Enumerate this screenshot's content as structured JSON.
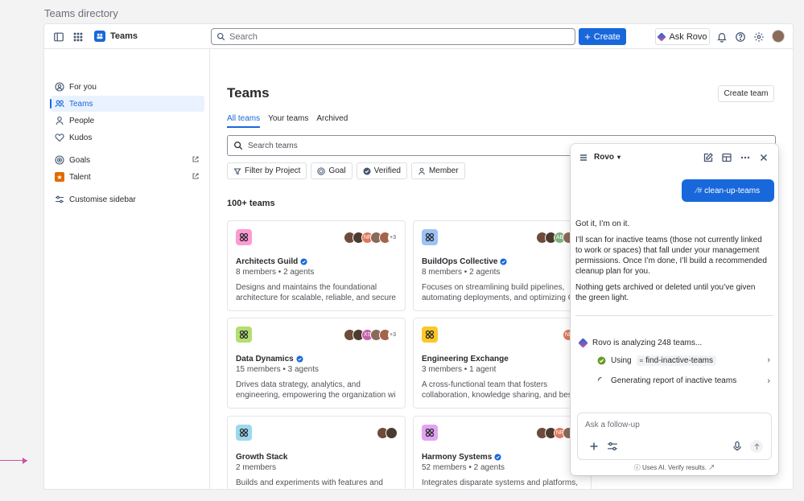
{
  "outer_title": "Teams directory",
  "topbar": {
    "app_name": "Teams",
    "search_placeholder": "Search",
    "create_label": "Create",
    "ask_rovo_label": "Ask Rovo"
  },
  "sidebar": {
    "items": [
      {
        "label": "For you",
        "icon": "person-circle-icon"
      },
      {
        "label": "Teams",
        "icon": "people-icon",
        "active": true
      },
      {
        "label": "People",
        "icon": "person-icon"
      },
      {
        "label": "Kudos",
        "icon": "heart-icon"
      },
      {
        "label": "Goals",
        "icon": "goal-icon"
      },
      {
        "label": "Talent",
        "icon": "talent-icon"
      },
      {
        "label": "Customise sidebar",
        "icon": "customise-icon"
      }
    ]
  },
  "main": {
    "title": "Teams",
    "create_team_label": "Create team",
    "tabs": [
      {
        "label": "All teams",
        "active": true
      },
      {
        "label": "Your teams"
      },
      {
        "label": "Archived"
      }
    ],
    "search_placeholder": "Search teams",
    "filters": [
      "Filter by Project",
      "Goal",
      "Verified",
      "Member"
    ],
    "count_label": "100+ teams"
  },
  "teams": [
    {
      "name": "Architects Guild",
      "verified": true,
      "meta": "8 members • 2 agents",
      "desc": "Designs and maintains the foundational architecture for scalable, reliable, and secure",
      "logo_color": "#fd9bd4",
      "avatars": [
        "",
        "",
        "NF",
        "",
        ""
      ],
      "more": "+3"
    },
    {
      "name": "BuildOps Collective",
      "verified": true,
      "meta": "8 members • 2 agents",
      "desc": "Focuses on streamlining build pipelines, automating deployments, and optimizing Clo",
      "logo_color": "#9dc2f5",
      "avatars": [
        "",
        "",
        "AE",
        "",
        ""
      ],
      "more": ""
    },
    {
      "name": "Data Dynamics",
      "verified": true,
      "meta": "15 members • 3 agents",
      "desc": "Drives data strategy, analytics, and engineering, empowering the organization wi",
      "logo_color": "#b3df72",
      "avatars": [
        "",
        "",
        "XS",
        "",
        ""
      ],
      "more": "+3"
    },
    {
      "name": "Engineering Exchange",
      "verified": false,
      "meta": "3 members • 1 agent",
      "desc": "A cross-functional team that fosters collaboration, knowledge sharing, and best",
      "logo_color": "#fbc828",
      "avatars": [
        "NF",
        ""
      ],
      "more": ""
    },
    {
      "name": "Growth Stack",
      "verified": false,
      "meta": "2 members",
      "desc": "Builds and experiments with features and tools that drive user acquisition, engagement, and",
      "logo_color": "#9dd9ee",
      "avatars": [
        "",
        ""
      ],
      "more": ""
    },
    {
      "name": "Harmony Systems",
      "verified": true,
      "meta": "52 members • 2 agents",
      "desc": "Integrates disparate systems and platforms, ensuring seamless interoperability and a uni",
      "logo_color": "#e2a4f2",
      "avatars": [
        "",
        "",
        "NF",
        "",
        ""
      ],
      "more": ""
    }
  ],
  "rovo": {
    "title": "Rovo",
    "user_message": "clean-up-teams",
    "bot_paragraphs": [
      "Got it, I’m on it.",
      "I’ll scan for inactive teams (those not currently linked to work or spaces) that fall under your management permissions. Once I’m done, I’ll build a recommended cleanup plan for you.",
      "Nothing gets archived or deleted until you’ve given the green light."
    ],
    "analyzing": "Rovo is analyzing 248 teams...",
    "using_label": "Using",
    "using_tool": "find-inactive-teams",
    "generating": "Generating report of inactive teams",
    "composer_placeholder": "Ask a follow-up",
    "footnote": "Uses AI. Verify results."
  },
  "colors": {
    "accent": "#1868db",
    "success": "#6a9a23"
  }
}
